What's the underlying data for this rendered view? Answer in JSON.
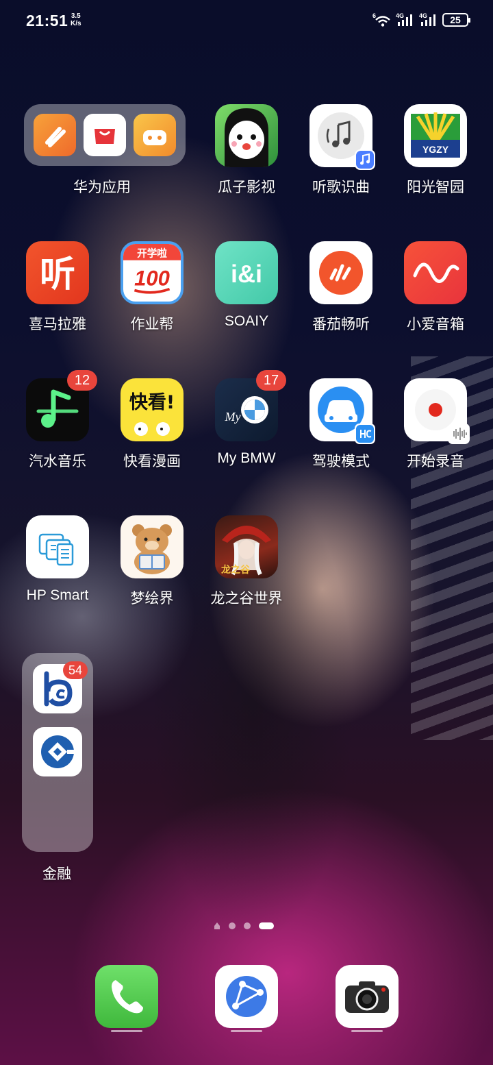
{
  "status_bar": {
    "time": "21:51",
    "net_speed_value": "3.5",
    "net_speed_unit": "K/s",
    "wifi_tag": "6",
    "sim1_tag": "4G",
    "sim2_tag": "4G",
    "battery": "25"
  },
  "folders": {
    "huawei": {
      "label": "华为应用",
      "mini_apps": [
        "huawei-health-icon",
        "huawei-appgallery-icon",
        "huawei-games-icon"
      ]
    },
    "finance": {
      "label": "金融",
      "badge": "54",
      "mini_apps": [
        "bocom-bank-icon",
        "ccb-bank-icon"
      ]
    }
  },
  "apps": [
    {
      "label": "瓜子影视",
      "icon": "guazi-video-icon"
    },
    {
      "label": "听歌识曲",
      "icon": "music-recognition-icon"
    },
    {
      "label": "阳光智园",
      "icon": "ygzy-icon",
      "icon_text": "YGZY"
    },
    {
      "label": "喜马拉雅",
      "icon": "ximalaya-icon",
      "icon_text": "听"
    },
    {
      "label": "作业帮",
      "icon": "zuoyebang-icon",
      "icon_text_top": "开学啦",
      "icon_text": "100"
    },
    {
      "label": "SOAIY",
      "icon": "soaiy-icon",
      "icon_text": "i&i"
    },
    {
      "label": "番茄畅听",
      "icon": "fanqie-icon"
    },
    {
      "label": "小爱音箱",
      "icon": "xiaoai-speaker-icon"
    },
    {
      "label": "汽水音乐",
      "icon": "qishui-music-icon",
      "badge": "12"
    },
    {
      "label": "快看漫画",
      "icon": "kuaikan-comic-icon",
      "icon_text": "快看!"
    },
    {
      "label": "My BMW",
      "icon": "bmw-icon",
      "badge": "17",
      "icon_text": "My"
    },
    {
      "label": "驾驶模式",
      "icon": "driving-mode-icon"
    },
    {
      "label": "开始录音",
      "icon": "voice-recorder-icon"
    },
    {
      "label": "HP Smart",
      "icon": "hp-smart-icon"
    },
    {
      "label": "梦绘界",
      "icon": "menghuijie-icon"
    },
    {
      "label": "龙之谷世界",
      "icon": "dragon-nest-icon",
      "icon_text": "龙之谷"
    }
  ],
  "page_indicator": {
    "total": 4,
    "current": 4
  },
  "dock": [
    {
      "name": "phone",
      "icon": "phone-icon",
      "color": "#52c74d"
    },
    {
      "name": "browser",
      "icon": "browser-icon",
      "color": "#3d7ae6"
    },
    {
      "name": "camera",
      "icon": "camera-icon",
      "color": "#2c2c2c"
    }
  ]
}
